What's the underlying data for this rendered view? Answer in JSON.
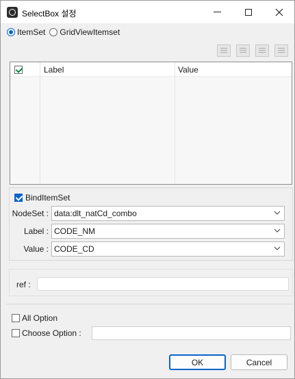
{
  "window": {
    "title": "SelectBox 설정",
    "controls": {
      "minimize": "minimize-icon",
      "maximize": "maximize-icon",
      "close": "close-icon"
    }
  },
  "itemset_mode": {
    "options": [
      "ItemSet",
      "GridViewItemset"
    ],
    "selected": "ItemSet"
  },
  "grid": {
    "columns": [
      "",
      "Label",
      "Value"
    ],
    "header_checkbox_checked": true,
    "rows": []
  },
  "bind": {
    "checkbox_label": "BindItemSet",
    "checked": true,
    "fields": [
      {
        "label": "NodeSet :",
        "value": "data:dlt_natCd_combo"
      },
      {
        "label": "Label :",
        "value": "CODE_NM"
      },
      {
        "label": "Value :",
        "value": "CODE_CD"
      }
    ]
  },
  "ref": {
    "label": "ref :",
    "value": ""
  },
  "options": {
    "all_option_label": "All Option",
    "all_option_checked": false,
    "choose_option_label": "Choose Option :",
    "choose_option_checked": false,
    "choose_option_value": ""
  },
  "buttons": {
    "ok": "OK",
    "cancel": "Cancel"
  },
  "colors": {
    "accent": "#0a63c9",
    "window_bg": "#f0f0f0"
  }
}
